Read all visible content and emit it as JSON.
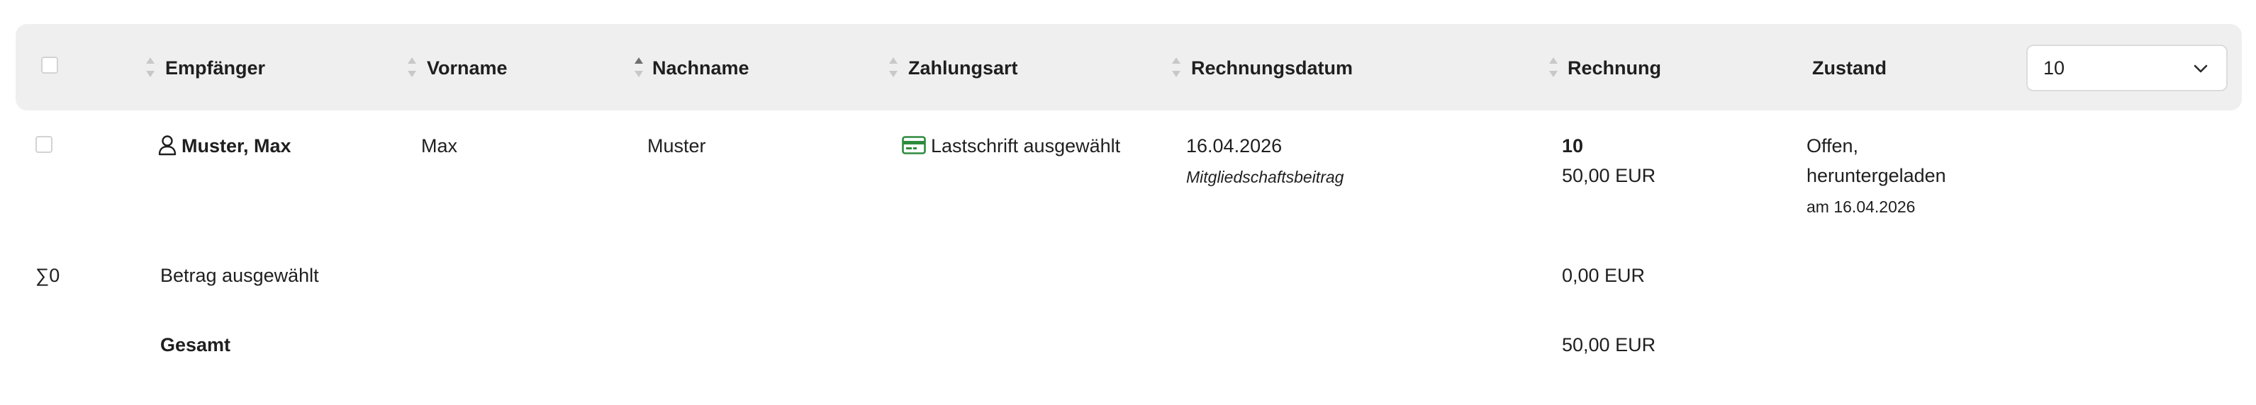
{
  "header": {
    "columns": {
      "recipient": "Empfänger",
      "first_name": "Vorname",
      "last_name": "Nachname",
      "payment_method": "Zahlungsart",
      "invoice_date": "Rechnungsdatum",
      "invoice": "Rechnung",
      "status": "Zustand"
    },
    "page_size_select": {
      "value": "10"
    },
    "sort": {
      "active_column": "last_name",
      "direction": "ascending"
    }
  },
  "rows": [
    {
      "recipient": "Muster, Max",
      "first_name": "Max",
      "last_name": "Muster",
      "payment_method": "Lastschrift ausgewählt",
      "invoice_date": "16.04.2026",
      "invoice_subject": "Mitgliedschaftsbeitrag",
      "invoice_number": "10",
      "invoice_amount": "50,00 EUR",
      "status_line1": "Offen,",
      "status_line2": "heruntergeladen",
      "status_date": "am 16.04.2026"
    }
  ],
  "summary": {
    "count": "∑0",
    "selected_label": "Betrag ausgewählt",
    "selected_amount": "0,00 EUR",
    "total_label": "Gesamt",
    "total_amount": "50,00 EUR"
  },
  "colors": {
    "header_bg": "#efefef",
    "payment_icon": "#2e8b3e",
    "sort_inactive": "#c8c8c8",
    "sort_active": "#6f6f6f"
  },
  "icons": {
    "recipient": "person-icon",
    "payment": "credit-card-icon",
    "select": "chevron-down-icon"
  }
}
